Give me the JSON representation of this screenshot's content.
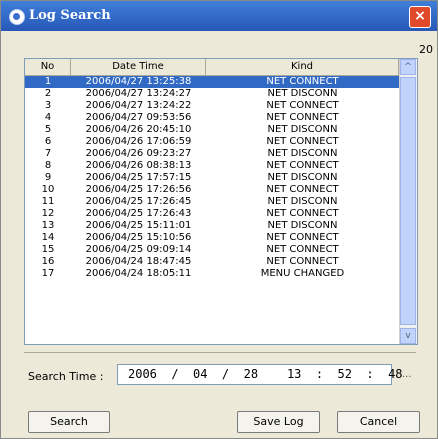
{
  "window": {
    "title": "Log Search",
    "close_icon": "×"
  },
  "record_count": "20",
  "columns": {
    "no": "No",
    "datetime": "Date Time",
    "kind": "Kind"
  },
  "rows": [
    {
      "no": "1",
      "datetime": "2006/04/27 13:25:38",
      "kind": "NET CONNECT",
      "selected": true
    },
    {
      "no": "2",
      "datetime": "2006/04/27 13:24:27",
      "kind": "NET DISCONN"
    },
    {
      "no": "3",
      "datetime": "2006/04/27 13:24:22",
      "kind": "NET CONNECT"
    },
    {
      "no": "4",
      "datetime": "2006/04/27 09:53:56",
      "kind": "NET CONNECT"
    },
    {
      "no": "5",
      "datetime": "2006/04/26 20:45:10",
      "kind": "NET DISCONN"
    },
    {
      "no": "6",
      "datetime": "2006/04/26 17:06:59",
      "kind": "NET CONNECT"
    },
    {
      "no": "7",
      "datetime": "2006/04/26 09:23:27",
      "kind": "NET DISCONN"
    },
    {
      "no": "8",
      "datetime": "2006/04/26 08:38:13",
      "kind": "NET CONNECT"
    },
    {
      "no": "9",
      "datetime": "2006/04/25 17:57:15",
      "kind": "NET DISCONN"
    },
    {
      "no": "10",
      "datetime": "2006/04/25 17:26:56",
      "kind": "NET CONNECT"
    },
    {
      "no": "11",
      "datetime": "2006/04/25 17:26:45",
      "kind": "NET DISCONN"
    },
    {
      "no": "12",
      "datetime": "2006/04/25 17:26:43",
      "kind": "NET CONNECT"
    },
    {
      "no": "13",
      "datetime": "2006/04/25 15:11:01",
      "kind": "NET DISCONN"
    },
    {
      "no": "14",
      "datetime": "2006/04/25 15:10:56",
      "kind": "NET CONNECT"
    },
    {
      "no": "15",
      "datetime": "2006/04/25 09:09:14",
      "kind": "NET CONNECT"
    },
    {
      "no": "16",
      "datetime": "2006/04/24 18:47:45",
      "kind": "NET CONNECT"
    },
    {
      "no": "17",
      "datetime": "2006/04/24 18:05:11",
      "kind": "MENU CHANGED"
    }
  ],
  "scrollbar": {
    "up_icon": "^",
    "down_icon": "v"
  },
  "search": {
    "label": "Search Time :",
    "value": "2006  /  04  /  28    13  :  52  :  48",
    "ellipsis": "..."
  },
  "buttons": {
    "search": "Search",
    "save_log": "Save Log",
    "cancel": "Cancel"
  },
  "colors": {
    "title_bar": "#2e63c4",
    "selection": "#316ac5",
    "close": "#e04a2a"
  }
}
